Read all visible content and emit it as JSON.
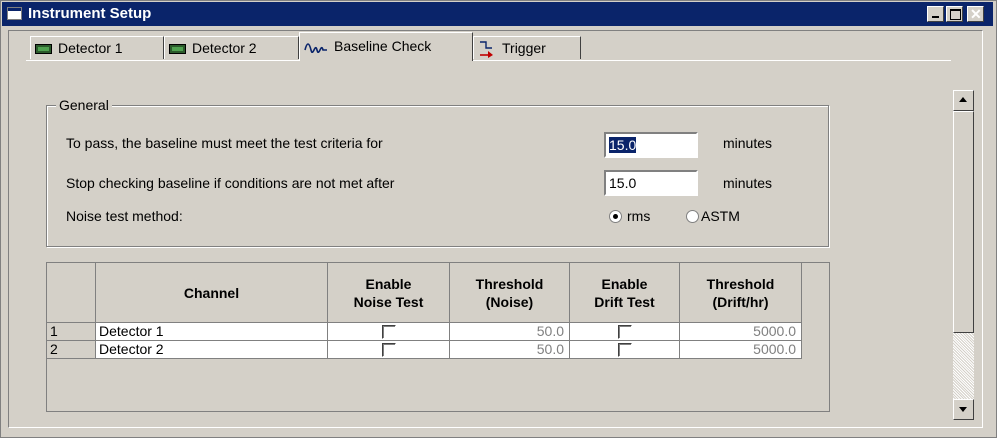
{
  "window": {
    "title": "Instrument Setup"
  },
  "tabs": [
    {
      "label": "Detector 1",
      "icon": "detector-icon"
    },
    {
      "label": "Detector 2",
      "icon": "detector-icon"
    },
    {
      "label": "Baseline Check",
      "icon": "baseline-wave-icon"
    },
    {
      "label": "Trigger",
      "icon": "trigger-icon"
    }
  ],
  "active_tab": "Baseline Check",
  "general": {
    "title": "General",
    "pass_label": "To pass, the baseline must meet the test criteria for",
    "pass_value": "15.0",
    "pass_unit": "minutes",
    "stop_label": "Stop checking baseline if conditions are not met after",
    "stop_value": "15.0",
    "stop_unit": "minutes",
    "noise_label": "Noise test method:",
    "noise_options": [
      "rms",
      "ASTM"
    ],
    "noise_selected": "rms"
  },
  "grid": {
    "headers": {
      "channel": "Channel",
      "enable_noise_1": "Enable",
      "enable_noise_2": "Noise Test",
      "threshold_noise_1": "Threshold",
      "threshold_noise_2": "(Noise)",
      "enable_drift_1": "Enable",
      "enable_drift_2": "Drift Test",
      "threshold_drift_1": "Threshold",
      "threshold_drift_2": "(Drift/hr)"
    },
    "rows": [
      {
        "index": "1",
        "channel": "Detector 1",
        "noise_enabled": false,
        "noise_threshold": "50.0",
        "drift_enabled": false,
        "drift_threshold": "5000.0"
      },
      {
        "index": "2",
        "channel": "Detector 2",
        "noise_enabled": false,
        "noise_threshold": "50.0",
        "drift_enabled": false,
        "drift_threshold": "5000.0"
      }
    ]
  },
  "colors": {
    "titlebar": "#0a246a",
    "face": "#d4d0c8"
  }
}
